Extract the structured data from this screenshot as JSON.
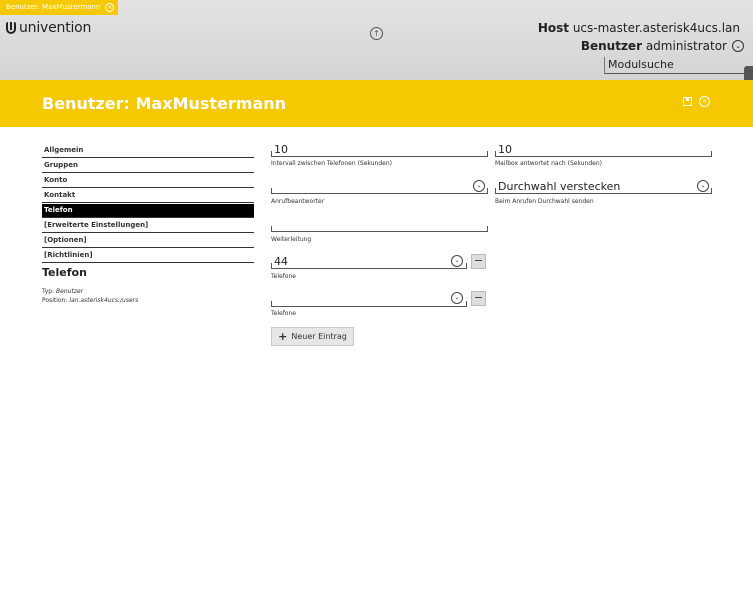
{
  "tab": {
    "title": "Benutzer: MaxMustermann"
  },
  "header": {
    "logo_text": "univention",
    "host_label": "Host",
    "host_value": "ucs-master.asterisk4ucs.lan",
    "user_label": "Benutzer",
    "user_value": "administrator",
    "search_placeholder": "Modulsuche"
  },
  "banner": {
    "title": "Benutzer: MaxMustermann"
  },
  "nav": {
    "items": [
      {
        "label": "Allgemein"
      },
      {
        "label": "Gruppen"
      },
      {
        "label": "Konto"
      },
      {
        "label": "Kontakt"
      },
      {
        "label": "Telefon",
        "active": true
      },
      {
        "label": "[Erweiterte Einstellungen]"
      },
      {
        "label": "[Optionen]"
      },
      {
        "label": "[Richtlinien]"
      }
    ]
  },
  "section": {
    "title": "Telefon",
    "type_label": "Typ:",
    "type_value": "Benutzer",
    "position_label": "Position:",
    "position_value": "lan.asterisk4ucs:/users"
  },
  "form": {
    "interval_value": "10",
    "interval_label": "Intervall zwischen Telefonen (Sekunden)",
    "mailbox_value": "10",
    "mailbox_label": "Mailbox antwortet nach (Sekunden)",
    "anrufbeantworter_value": "",
    "anrufbeantworter_label": "Anrufbeantworter",
    "durchwahl_value": "Durchwahl verstecken",
    "durchwahl_label": "Beim Anrufen Durchwahl senden",
    "weiterleitung_value": "",
    "weiterleitung_label": "Weiterleitung",
    "telefone": [
      {
        "value": "44",
        "label": "Telefone"
      },
      {
        "value": "",
        "label": "Telefone"
      }
    ],
    "add_button": "Neuer Eintrag"
  }
}
